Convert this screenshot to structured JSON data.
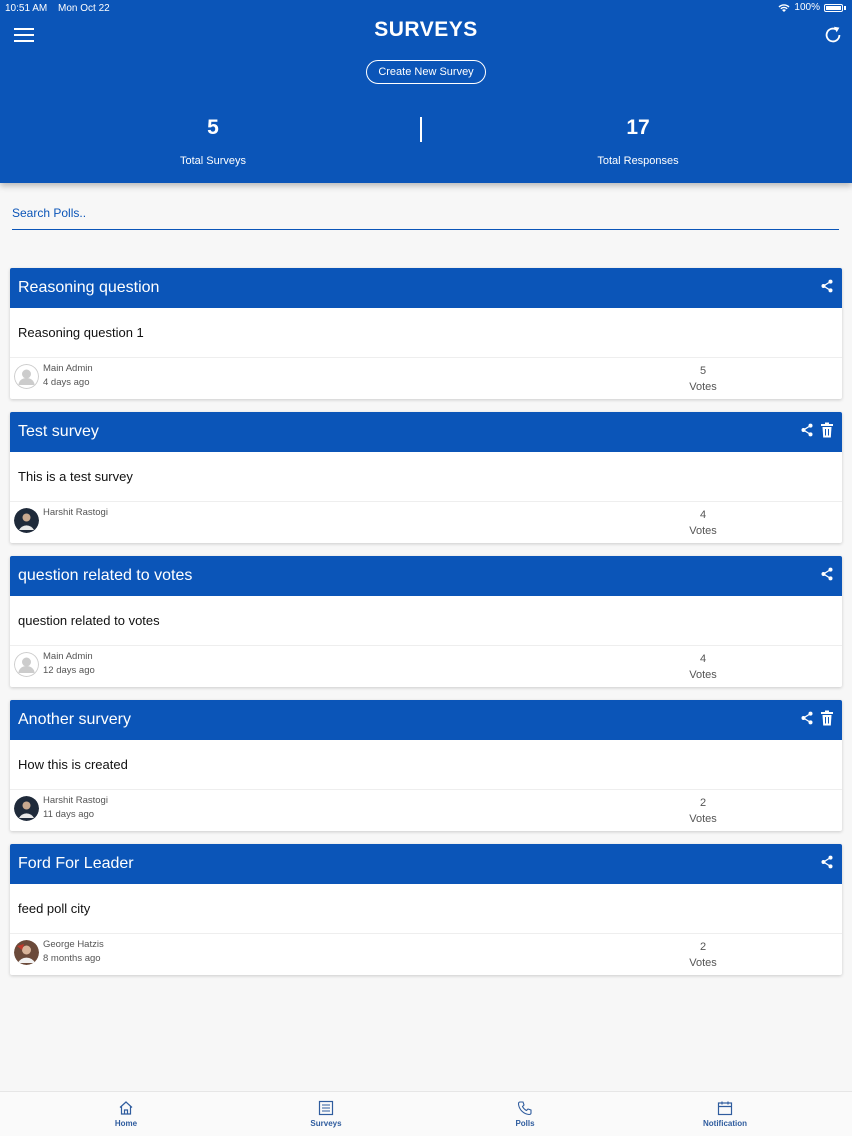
{
  "status_bar": {
    "time": "10:51 AM",
    "date": "Mon Oct 22",
    "battery": "100%"
  },
  "header": {
    "title": "SURVEYS",
    "create_button": "Create New Survey",
    "stats": [
      {
        "value": "5",
        "label": "Total Surveys"
      },
      {
        "value": "17",
        "label": "Total Responses"
      }
    ]
  },
  "search": {
    "placeholder": "Search Polls.."
  },
  "surveys": [
    {
      "title": "Reasoning question",
      "question": "Reasoning question 1",
      "author": "Main Admin",
      "ago": "4 days ago",
      "votes": "5",
      "votes_label": "Votes",
      "can_delete": false,
      "avatar": "default"
    },
    {
      "title": "Test survey",
      "question": "This is a test survey",
      "author": "Harshit Rastogi",
      "ago": "",
      "votes": "4",
      "votes_label": "Votes",
      "can_delete": true,
      "avatar": "photo"
    },
    {
      "title": "question related to votes",
      "question": "question related to votes",
      "author": "Main Admin",
      "ago": "12 days ago",
      "votes": "4",
      "votes_label": "Votes",
      "can_delete": false,
      "avatar": "default"
    },
    {
      "title": "Another survery",
      "question": "How this is created",
      "author": "Harshit Rastogi",
      "ago": "11 days ago",
      "votes": "2",
      "votes_label": "Votes",
      "can_delete": true,
      "avatar": "photo"
    },
    {
      "title": "Ford For Leader",
      "question": "feed poll city",
      "author": "George Hatzis",
      "ago": "8 months ago",
      "votes": "2",
      "votes_label": "Votes",
      "can_delete": false,
      "avatar": "photo2"
    }
  ],
  "tabs": [
    {
      "label": "Home",
      "icon": "home-icon"
    },
    {
      "label": "Surveys",
      "icon": "list-icon"
    },
    {
      "label": "Polls",
      "icon": "phone-icon"
    },
    {
      "label": "Notification",
      "icon": "calendar-icon"
    }
  ],
  "colors": {
    "primary": "#0b55b8",
    "tab_label": "#2f5c9e",
    "background": "#f7f7f7"
  }
}
